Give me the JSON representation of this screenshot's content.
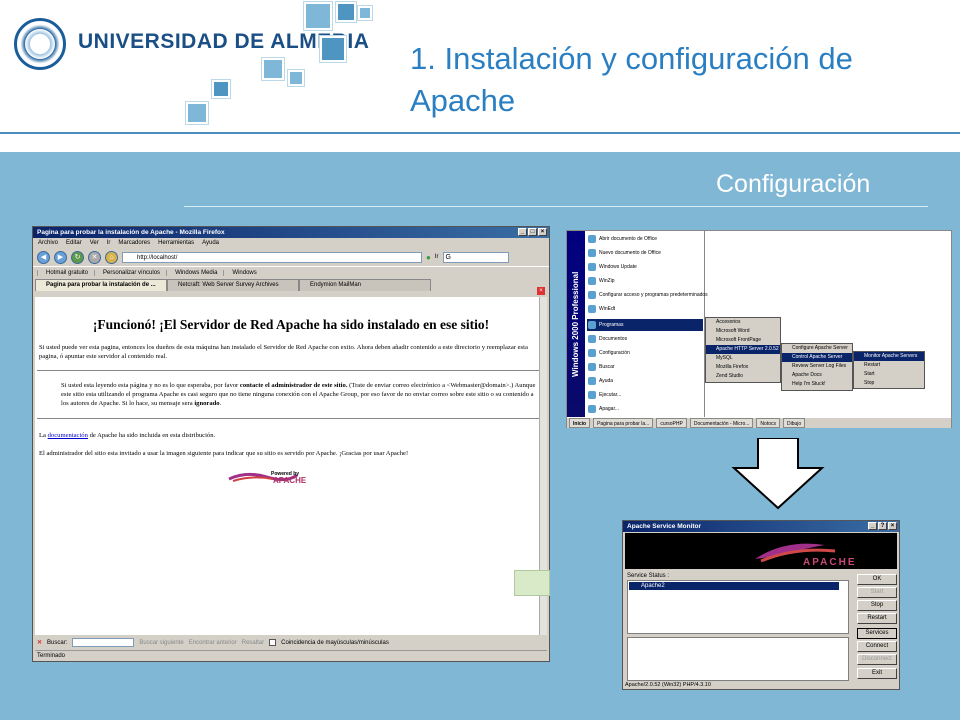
{
  "header": {
    "university": "UNIVERSIDAD DE ALMERIA",
    "title": "1. Instalación y configuración de Apache",
    "section": "Configuración"
  },
  "firefox": {
    "window_title": "Pagina para probar la instalación de Apache - Mozilla Firefox",
    "menu": [
      "Archivo",
      "Editar",
      "Ver",
      "Ir",
      "Marcadores",
      "Herramientas",
      "Ayuda"
    ],
    "url": "http://localhost/",
    "go_label": "Ir",
    "bookmarks": [
      "Hotmail gratuito",
      "Personalizar vínculos",
      "Windows Media",
      "Windows"
    ],
    "tabs": [
      "Pagina para probar la instalación de ...",
      "Netcraft: Web Server Survey Archives",
      "Endymion MailMan"
    ],
    "page": {
      "heading": "¡Funcionó! ¡El Servidor de Red Apache ha sido instalado en ese sitio!",
      "p1": "Si usted puede ver esta pagina, entonces los dueños de esta máquina han instalado el Servidor de Red Apache con exito. Ahora deben añadir contenido a este directorio y reemplazar esta pagina, ó apuntar este servidor al contenido real.",
      "p2a": "Si usted esta leyendo esta página y no es lo que esperaba, por favor",
      "p2b": "contacte el administrador de este sitio.",
      "p2c": "(Trate de enviar correo electrónico a <Webmaster@domain>.) Aunque este sitio esta utilizando el programa Apache es casi seguro que no tiene ninguna conexión con el Apache Group, por eso favor de no enviar correo sobre este sitio o su contenido a los autores de Apache. Si lo hace, su mensaje sera",
      "p2d": "ignorado",
      "p3a": "La",
      "p3link": "documentación",
      "p3b": "de Apache ha sido incluida en esta distribución.",
      "p4": "El administrador del sitio esta invitado a usar la imagen siguiente para indicar que su sitio es servido por Apache. ¡Gracias por usar Apache!",
      "powered": "Powered by",
      "powered_brand": "APACHE"
    },
    "find": {
      "label": "Buscar:",
      "next": "Buscar siguiente",
      "prev": "Encontrar anterior",
      "highlight": "Resaltar",
      "match_case": "Coincidencia de mayúsculas/minúsculas"
    },
    "status": "Terminado"
  },
  "startmenu": {
    "strip": "Windows 2000 Professional",
    "items": [
      "Abrir documento de Office",
      "Nuevo documento de Office",
      "Windows Update",
      "WinZip",
      "Configurar acceso y programas predeterminados",
      "WinEdt",
      "Programas",
      "Documentos",
      "Configuración",
      "Buscar",
      "Ayuda",
      "Ejecutar...",
      "Apagar..."
    ],
    "programs": [
      "Accesorios",
      "Microsoft Word",
      "Microsoft FrontPage",
      "Apache HTTP Server 2.0.52",
      "MySQL",
      "Mozilla Firefox",
      "Zend Studio"
    ],
    "apache": [
      "Configure Apache Server",
      "Control Apache Server",
      "Review Server Log Files",
      "Apache Docs",
      "Help I'm Stuck!"
    ],
    "control": [
      "Monitor Apache Servers",
      "Restart",
      "Start",
      "Stop"
    ],
    "taskbar": [
      "Inicio",
      "Pagina para probar la...",
      "cursoPHP",
      "Documentación - Micro...",
      "Notocs",
      "Dibujo"
    ]
  },
  "svcmon": {
    "title": "Apache Service Monitor",
    "brand": "APACHE",
    "status_label": "Service Status :",
    "service": "Apache2",
    "buttons": [
      "OK",
      "Start",
      "Stop",
      "Restart",
      "Services",
      "Connect",
      "Disconnect",
      "Exit"
    ],
    "version": "Apache/2.0.52 (Win32) PHP/4.3.10"
  },
  "colors": {
    "accent": "#2a7fc2",
    "panel": "#7fb7d4"
  }
}
